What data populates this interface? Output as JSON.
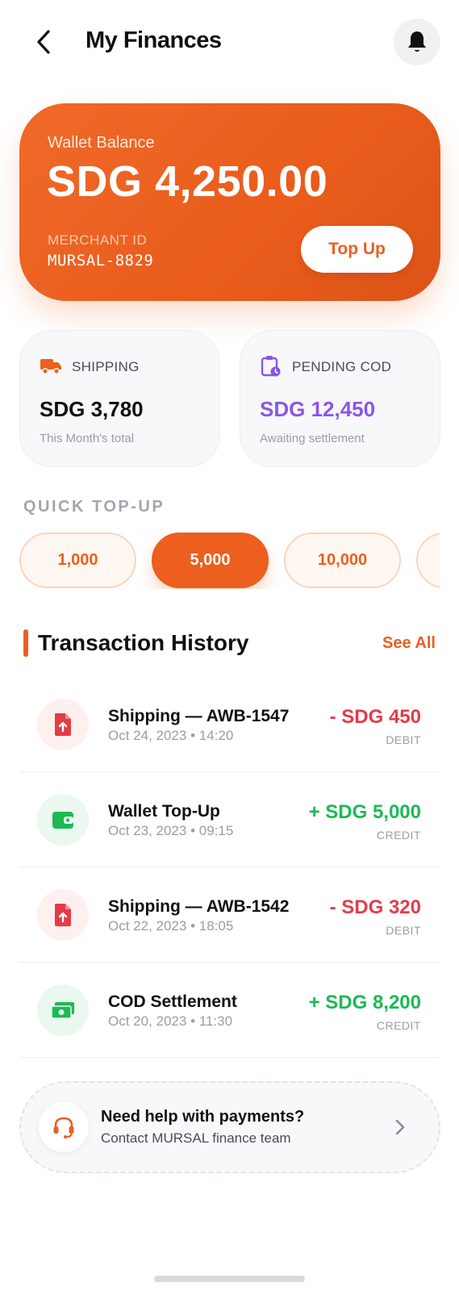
{
  "header": {
    "title": "My Finances",
    "back_icon": "chevron-left-icon",
    "notification_icon": "bell-icon"
  },
  "wallet": {
    "label": "Wallet Balance",
    "balance": "SDG 4,250.00",
    "merchant_label": "MERCHANT ID",
    "merchant_id": "MURSAL-8829",
    "topup_label": "Top Up"
  },
  "stats": {
    "shipping": {
      "icon": "truck-icon",
      "title": "SHIPPING",
      "value": "SDG 3,780",
      "subtitle": "This Month's total"
    },
    "pending_cod": {
      "icon": "clipboard-clock-icon",
      "title": "PENDING COD",
      "value": "SDG 12,450",
      "subtitle": "Awaiting settlement"
    }
  },
  "quick_topup": {
    "label": "QUICK TOP-UP",
    "options": [
      {
        "label": "1,000",
        "selected": false
      },
      {
        "label": "5,000",
        "selected": true
      },
      {
        "label": "10,000",
        "selected": false
      },
      {
        "label": "",
        "selected": false
      }
    ]
  },
  "transactions": {
    "title": "Transaction History",
    "see_all": "See All",
    "items": [
      {
        "title": "Shipping — AWB-1547",
        "date": "Oct 24, 2023 • 14:20",
        "amount": "- SDG 450",
        "type": "DEBIT",
        "kind": "debit",
        "icon": "file-upload-icon"
      },
      {
        "title": "Wallet Top-Up",
        "date": "Oct 23, 2023 • 09:15",
        "amount": "+ SDG 5,000",
        "type": "CREDIT",
        "kind": "credit",
        "icon": "wallet-icon"
      },
      {
        "title": "Shipping — AWB-1542",
        "date": "Oct 22, 2023 • 18:05",
        "amount": "- SDG 320",
        "type": "DEBIT",
        "kind": "debit",
        "icon": "file-upload-icon"
      },
      {
        "title": "COD Settlement",
        "date": "Oct 20, 2023 • 11:30",
        "amount": "+ SDG 8,200",
        "type": "CREDIT",
        "kind": "credit",
        "icon": "cash-icon"
      }
    ]
  },
  "help": {
    "title": "Need help with payments?",
    "subtitle": "Contact MURSAL finance team",
    "icon": "headset-icon",
    "chevron_icon": "chevron-right-icon"
  },
  "colors": {
    "accent": "#ec5f1f",
    "debit": "#e53b47",
    "credit": "#1db954",
    "cod": "#8b55e9"
  }
}
